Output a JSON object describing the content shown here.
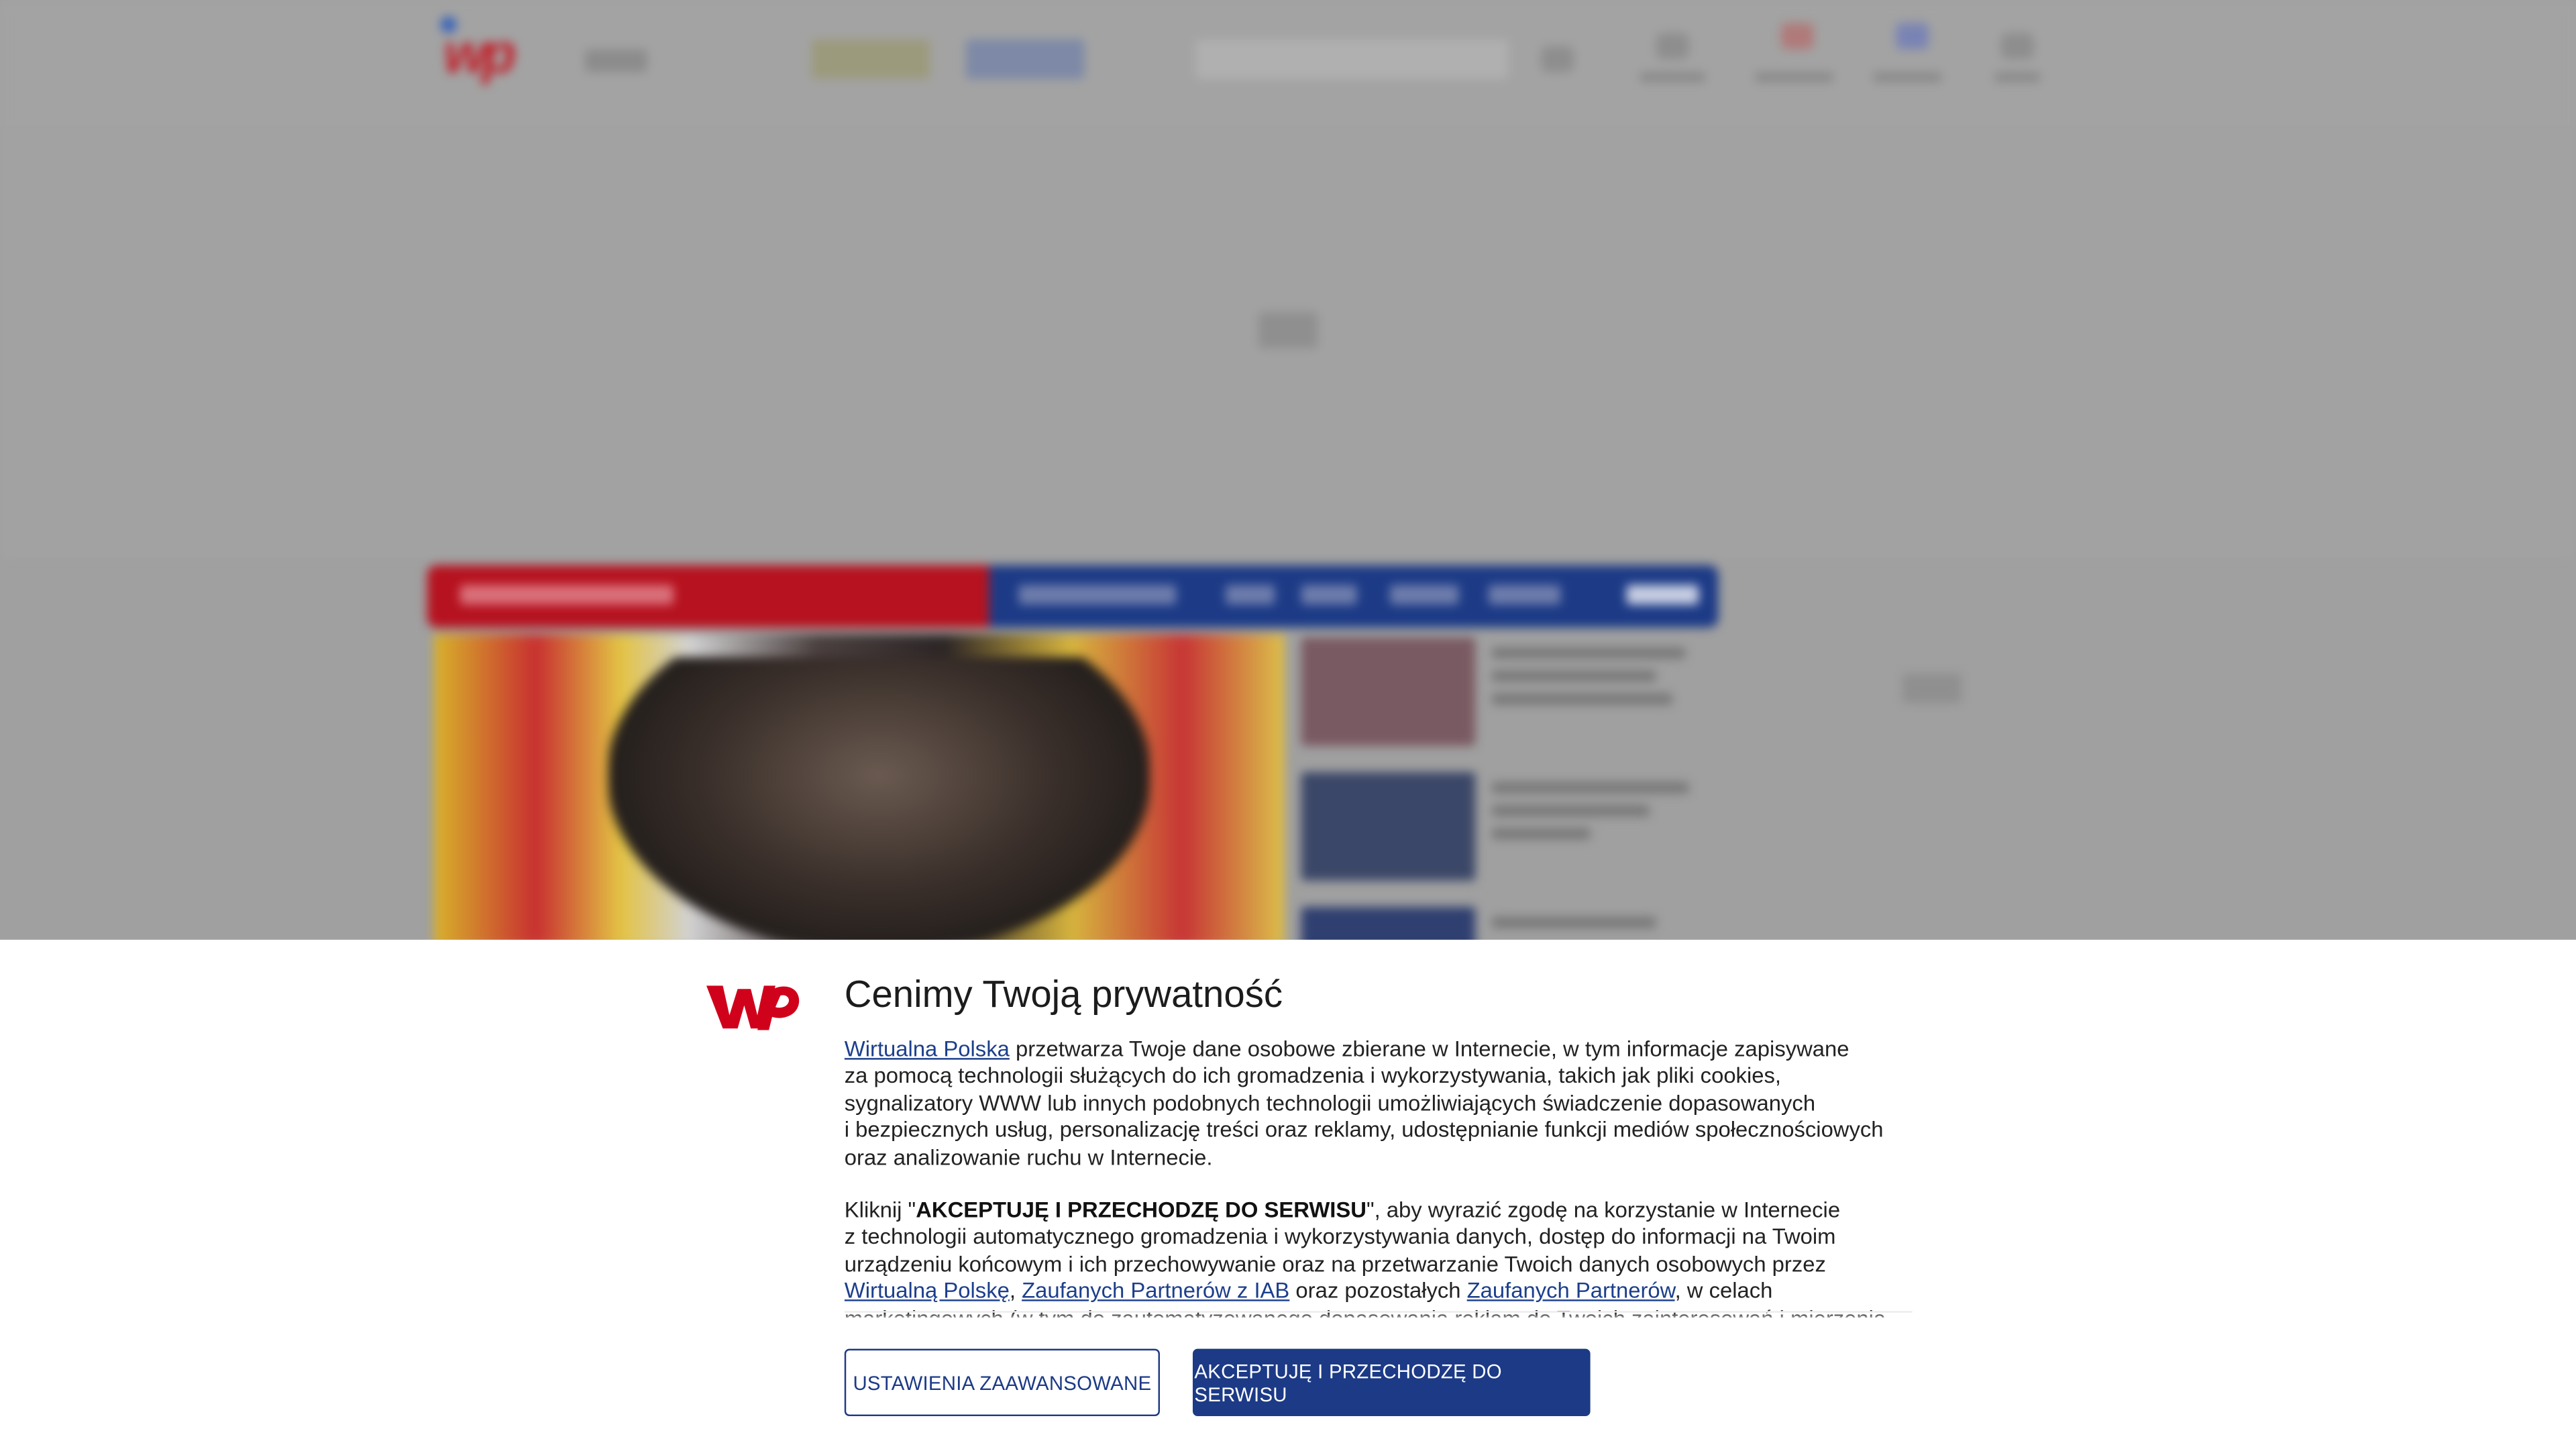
{
  "consent": {
    "title": "Cenimy Twoją prywatność",
    "paragraph1": {
      "link_wp": "Wirtualna Polska",
      "line1_rest": " przetwarza Twoje dane osobowe zbierane w Internecie, w tym informacje zapisywane",
      "line2": "za pomocą technologii służących do ich gromadzenia i wykorzystywania, takich jak pliki cookies,",
      "line3": "sygnalizatory WWW lub innych podobnych technologii umożliwiających świadczenie dopasowanych",
      "line4": "i bezpiecznych usług, personalizację treści oraz reklamy, udostępnianie funkcji mediów społecznościowych",
      "line5": "oraz analizowanie ruchu w Internecie."
    },
    "paragraph2": {
      "line1_pre": "Kliknij \"",
      "line1_bold": "AKCEPTUJĘ I PRZECHODZĘ DO SERWISU",
      "line1_post": "\", aby wyrazić zgodę na korzystanie w Internecie",
      "line2": "z technologii automatycznego gromadzenia i wykorzystywania danych, dostęp do informacji na Twoim",
      "line3": "urządzeniu końcowym i ich przechowywanie oraz na przetwarzanie Twoich danych osobowych przez",
      "link_wp2": "Wirtualną Polskę",
      "sep1": ", ",
      "link_iab": "Zaufanych Partnerów z IAB",
      "mid": " oraz pozostałych ",
      "link_partners": "Zaufanych Partnerów",
      "line4_post": ", w celach",
      "line5": "marketingowych (w tym do zautomatyzowanego dopasowania reklam do Twoich zainteresowań i mierzenia"
    },
    "buttons": {
      "advanced_settings": "USTAWIENIA ZAAWANSOWANE",
      "accept": "AKCEPTUJĘ I PRZECHODZĘ DO SERWISU"
    }
  },
  "colors": {
    "brand_red": "#d0021b",
    "brand_navy": "#1c3a86",
    "link": "#1c3f8c",
    "overlay_gray": "#a0a0a0"
  }
}
